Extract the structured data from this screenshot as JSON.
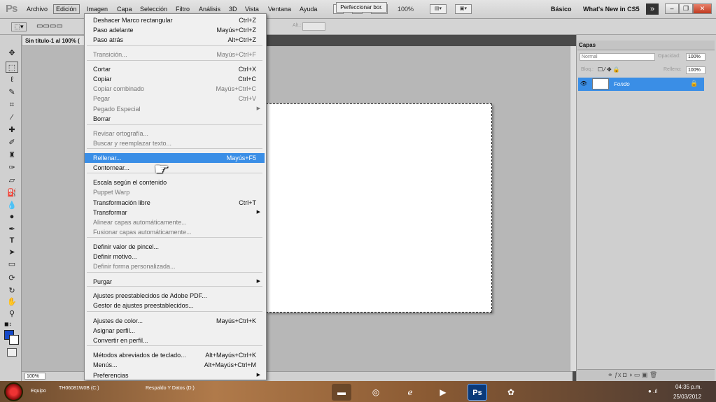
{
  "app": {
    "logo": "Ps"
  },
  "menubar": {
    "items": [
      "Archivo",
      "Edición",
      "Imagen",
      "Capa",
      "Selección",
      "Filtro",
      "Análisis",
      "3D",
      "Vista",
      "Ventana",
      "Ayuda"
    ],
    "br": "Br",
    "mb": "Mb",
    "zoom": "100%",
    "workspace": "Básico",
    "whats_new": "What's New in CS5"
  },
  "options": {
    "refine": "Perfeccionar bor.",
    "alt": "Alt.:"
  },
  "document": {
    "tab": "Sin título-1 al 100% (",
    "zoom": "100%"
  },
  "menu": {
    "items": [
      {
        "label": "Deshacer Marco rectangular",
        "sc": "Ctrl+Z",
        "dis": false
      },
      {
        "label": "Paso adelante",
        "sc": "Mayús+Ctrl+Z",
        "dis": false
      },
      {
        "label": "Paso atrás",
        "sc": "Alt+Ctrl+Z",
        "dis": false
      },
      {
        "label": "Transición...",
        "sc": "Mayús+Ctrl+F",
        "dis": true
      },
      {
        "label": "Cortar",
        "sc": "Ctrl+X",
        "dis": false
      },
      {
        "label": "Copiar",
        "sc": "Ctrl+C",
        "dis": false
      },
      {
        "label": "Copiar combinado",
        "sc": "Mayús+Ctrl+C",
        "dis": true
      },
      {
        "label": "Pegar",
        "sc": "Ctrl+V",
        "dis": true
      },
      {
        "label": "Pegado Especial",
        "sc": "",
        "dis": true,
        "sub": true
      },
      {
        "label": "Borrar",
        "sc": "",
        "dis": false
      },
      {
        "label": "Revisar ortografía...",
        "sc": "",
        "dis": true
      },
      {
        "label": "Buscar y reemplazar texto...",
        "sc": "",
        "dis": true
      },
      {
        "label": "Rellenar...",
        "sc": "Mayús+F5",
        "dis": false,
        "hl": true
      },
      {
        "label": "Contornear...",
        "sc": "",
        "dis": false
      },
      {
        "label": "Escala según el contenido",
        "sc": "",
        "dis": false
      },
      {
        "label": "Puppet Warp",
        "sc": "",
        "dis": true
      },
      {
        "label": "Transformación libre",
        "sc": "Ctrl+T",
        "dis": false
      },
      {
        "label": "Transformar",
        "sc": "",
        "dis": false,
        "sub": true
      },
      {
        "label": "Alinear capas automáticamente...",
        "sc": "",
        "dis": true
      },
      {
        "label": "Fusionar capas automáticamente...",
        "sc": "",
        "dis": true
      },
      {
        "label": "Definir valor de pincel...",
        "sc": "",
        "dis": false
      },
      {
        "label": "Definir motivo...",
        "sc": "",
        "dis": false
      },
      {
        "label": "Definir forma personalizada...",
        "sc": "",
        "dis": true
      },
      {
        "label": "Purgar",
        "sc": "",
        "dis": false,
        "sub": true
      },
      {
        "label": "Ajustes preestablecidos de Adobe PDF...",
        "sc": "",
        "dis": false
      },
      {
        "label": "Gestor de ajustes preestablecidos...",
        "sc": "",
        "dis": false
      },
      {
        "label": "Ajustes de color...",
        "sc": "Mayús+Ctrl+K",
        "dis": false
      },
      {
        "label": "Asignar perfil...",
        "sc": "",
        "dis": false
      },
      {
        "label": "Convertir en perfil...",
        "sc": "",
        "dis": false
      },
      {
        "label": "Métodos abreviados de teclado...",
        "sc": "Alt+Mayús+Ctrl+K",
        "dis": false
      },
      {
        "label": "Menús...",
        "sc": "Alt+Mayús+Ctrl+M",
        "dis": false
      },
      {
        "label": "Preferencias",
        "sc": "",
        "dis": false,
        "sub": true
      }
    ]
  },
  "layers": {
    "tab": "Capas",
    "blend": "Normal",
    "opacity_label": "Opacidad:",
    "opacity": "100%",
    "lock_label": "Bloq.:",
    "fill_label": "Relleno:",
    "fill": "100%",
    "layer_name": "Fondo"
  },
  "taskbar": {
    "t1": "Equipo",
    "t2": "TH06081W0B (C:)",
    "t3": "Respaldo Y Datos (D:)",
    "ps": "Ps",
    "time": "04:35 p.m.",
    "date": "25/03/2012"
  },
  "colors": {
    "highlight": "#3a8ee6",
    "foreground": "#1448c8"
  }
}
